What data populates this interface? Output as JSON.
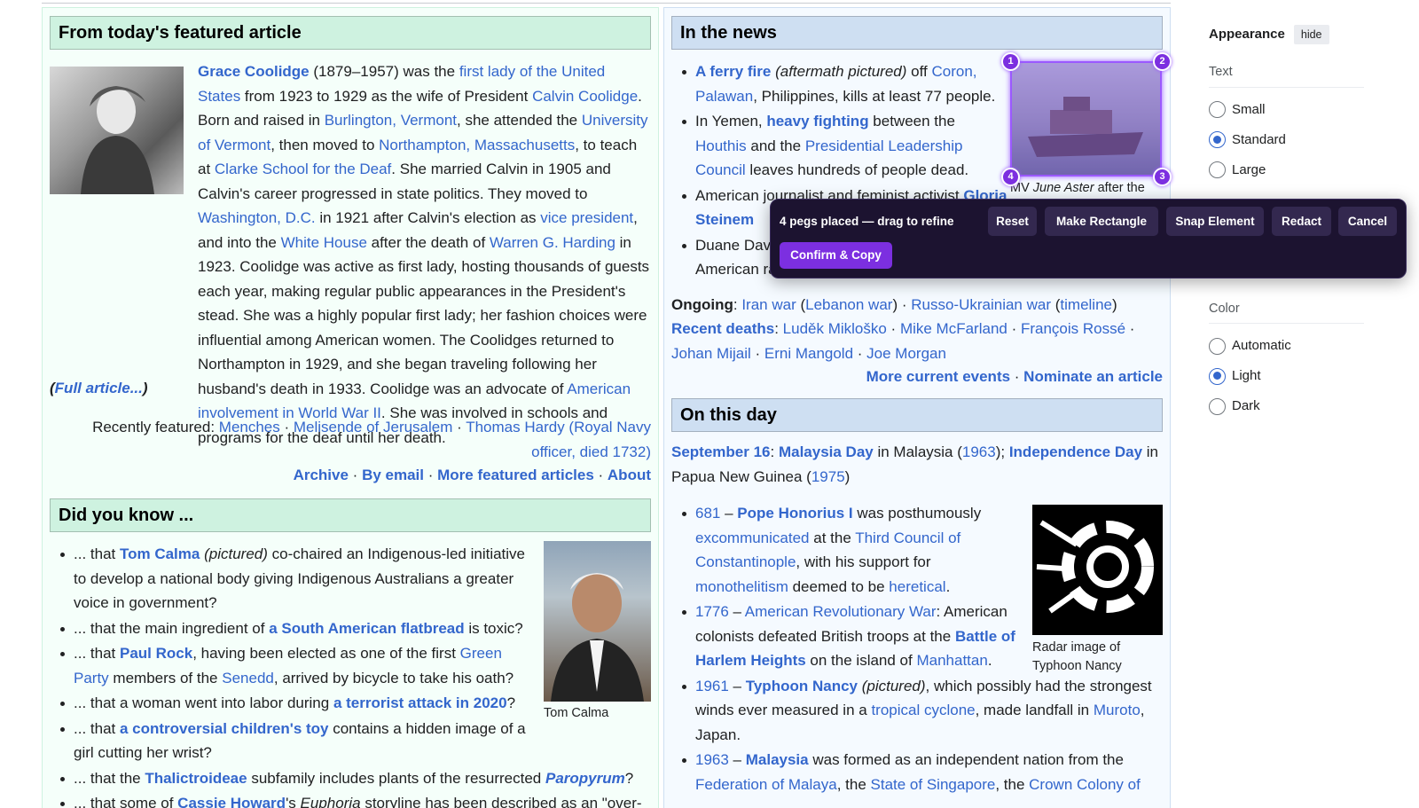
{
  "featured": {
    "heading": "From today's featured article",
    "p1": "Grace Coolidge",
    "p2": " (1879–1957) was the ",
    "p3": "first lady of the United States",
    "p4": " from 1923 to 1929 as the wife of President ",
    "p5": "Calvin Coolidge",
    "p6": ". Born and raised in ",
    "p7": "Burlington, Vermont",
    "p8": ", she attended the ",
    "p9": "University of Vermont",
    "p10": ", then moved to ",
    "p11": "Northampton, Massachusetts",
    "p12": ", to teach at ",
    "p13": "Clarke School for the Deaf",
    "p14": ". She married Calvin in 1905 and Calvin's career progressed in state politics. They moved to ",
    "p15": "Washington, D.C.",
    "p16": " in 1921 after Calvin's election as ",
    "p17": "vice president",
    "p18": ", and into the ",
    "p19": "White House",
    "p20": " after the death of ",
    "p21": "Warren G. Harding",
    "p22": " in 1923. Coolidge was active as first lady, hosting thousands of guests each year, making regular public appearances in the President's stead. She was a highly popular first lady; her fashion choices were influential among American women. The Coolidges returned to Northampton in 1929, and she began traveling following her husband's death in 1933. Coolidge was an advocate of ",
    "p23": "American involvement in World War II",
    "p24": ". She was involved in schools and programs for the deaf until her death.",
    "full_open": "(",
    "full_link": "Full article...",
    "full_close": ")",
    "recent_label": "Recently featured: ",
    "recent1": "Menches",
    "recent2": "Melisende of Jerusalem",
    "recent3": "Thomas Hardy (Royal Navy officer, died 1732)",
    "sep": " · ",
    "archive": "Archive",
    "email": "By email",
    "more": "More featured articles",
    "about": "About"
  },
  "dyk": {
    "heading": "Did you know ...",
    "caption": "Tom Calma",
    "i1a": "... that ",
    "i1b": "Tom Calma",
    "i1c": " (pictured)",
    "i1d": " co-chaired an Indigenous-led initiative to develop a national body giving Indigenous Australians a greater voice in government?",
    "i2a": "... that the main ingredient of ",
    "i2b": "a South American flatbread",
    "i2c": " is toxic?",
    "i3a": "... that ",
    "i3b": "Paul Rock",
    "i3c": ", having been elected as one of the first ",
    "i3d": "Green Party",
    "i3e": " members of the ",
    "i3f": "Senedd",
    "i3g": ", arrived by bicycle to take his oath?",
    "i4a": "... that a woman went into labor during ",
    "i4b": "a terrorist attack in 2020",
    "i4c": "?",
    "i5a": "... that ",
    "i5b": "a controversial children's toy",
    "i5c": " contains a hidden image of a girl cutting her wrist?",
    "i6a": "... that the ",
    "i6b": "Thalictroideae",
    "i6c": " subfamily includes plants of the resurrected ",
    "i6d": "Paropyrum",
    "i6e": "?",
    "i7a": "... that some of ",
    "i7b": "Cassie Howard",
    "i7c": "'s ",
    "i7d": "Euphoria",
    "i7e": " storyline has been described as an \"over-"
  },
  "news": {
    "heading": "In the news",
    "n1a": "A ferry fire",
    "n1b": " (aftermath pictured)",
    "n1c": " off ",
    "n1d": "Coron, Palawan",
    "n1e": ", Philippines, kills at least 77 people.",
    "n2a": "In Yemen, ",
    "n2b": "heavy fighting",
    "n2c": " between the ",
    "n2d": "Houthis",
    "n2e": " and the ",
    "n2f": "Presidential Leadership Council",
    "n2g": " leaves hundreds of people dead.",
    "n3a": "American journalist and feminist activist ",
    "n3b": "Gloria Steinem",
    "n4a": "Duane Davis",
    "n4b": "American ra",
    "img_caption_a": "MV ",
    "img_caption_b": "June Aster",
    "img_caption_c": " after the",
    "ongoing_label": "Ongoing",
    "ongoing1": "Iran war",
    "ongoing2": "Lebanon war",
    "ongoing3": "Russo-Ukrainian war",
    "ongoing4": "timeline",
    "deaths_label": "Recent deaths",
    "d1": "Luděk Mikloško",
    "d2": "Mike McFarland",
    "d3": "François Rossé",
    "d4": "Johan Mijail",
    "d5": "Erni Mangold",
    "d6": "Joe Morgan",
    "more_events": "More current events",
    "nominate": "Nominate an article"
  },
  "otd": {
    "heading": "On this day",
    "date": "September 16",
    "day1": "Malaysia Day",
    "in_malaysia": " in Malaysia (",
    "y1963": "1963",
    "semi": "); ",
    "day2": "Independence Day",
    "png": " in Papua New Guinea (",
    "y1975": "1975",
    "close": ")",
    "e1a": "681",
    "e1b": " – ",
    "e1c": "Pope Honorius I",
    "e1d": " was posthumously ",
    "e1e": "excommunicated",
    "e1f": " at the ",
    "e1g": "Third Council of Constantinople",
    "e1h": ", with his support for ",
    "e1i": "monothelitism",
    "e1j": " deemed to be ",
    "e1k": "heretical",
    "e1l": ".",
    "e2a": "1776",
    "e2c": "American Revolutionary War",
    "e2d": ": American colonists defeated British troops at the ",
    "e2e": "Battle of Harlem Heights",
    "e2f": " on the island of ",
    "e2g": "Manhattan",
    "e2h": ".",
    "e3a": "1961",
    "e3c": "Typhoon Nancy",
    "e3d": " (pictured)",
    "e3e": ", which possibly had the strongest winds ever measured in a ",
    "e3f": "tropical cyclone",
    "e3g": ", made landfall in ",
    "e3h": "Muroto",
    "e3i": ", Japan.",
    "e4a": "1963",
    "e4c": "Malaysia",
    "e4d": " was formed as an independent nation from the ",
    "e4e": "Federation of Malaya",
    "e4f": ", the ",
    "e4g": "State of Singapore",
    "e4h": ", the ",
    "e4i": "Crown Colony of",
    "img_caption": "Radar image of Typhoon Nancy"
  },
  "appearance": {
    "title": "Appearance",
    "hide": "hide",
    "text_label": "Text",
    "text_options": [
      "Small",
      "Standard",
      "Large"
    ],
    "text_selected": "Standard",
    "color_label": "Color",
    "color_options": [
      "Automatic",
      "Light",
      "Dark"
    ],
    "color_selected": "Light"
  },
  "toolbar": {
    "status": "4 pegs placed — drag to refine",
    "reset": "Reset",
    "rectangle": "Make Rectangle",
    "snap": "Snap Element",
    "redact": "Redact",
    "cancel": "Cancel",
    "confirm": "Confirm & Copy",
    "pegs": [
      "1",
      "2",
      "3",
      "4"
    ]
  },
  "colors": {
    "link": "#3366cc",
    "accent": "#7c2fe0",
    "toolbar_bg": "#1c1330"
  }
}
